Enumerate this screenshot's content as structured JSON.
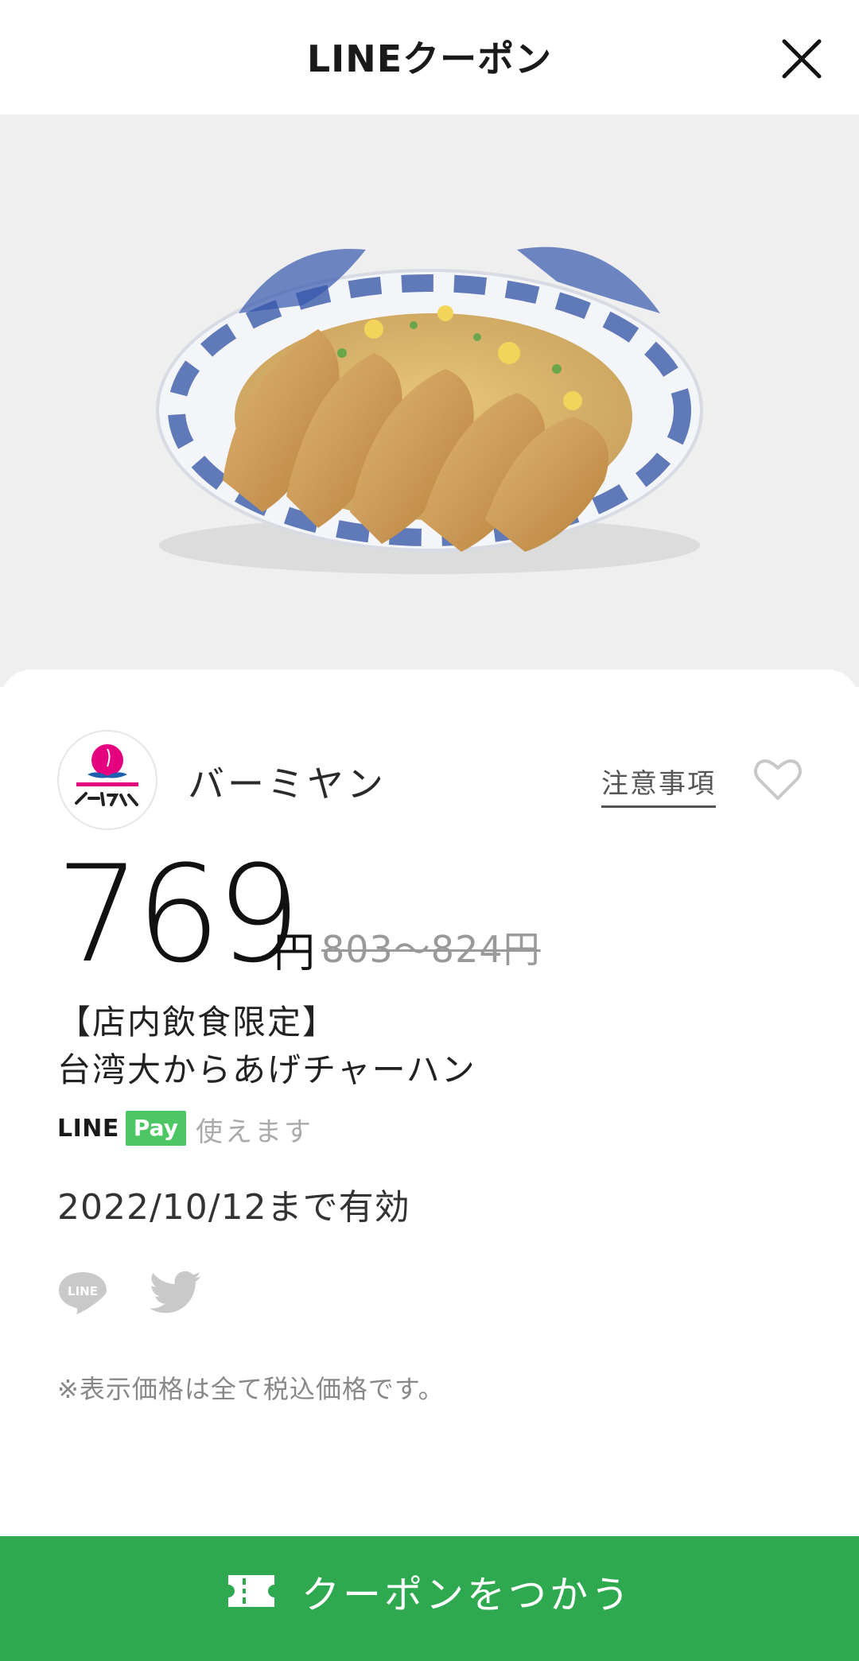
{
  "header": {
    "title": "LINEクーポン",
    "close_icon": "close-icon"
  },
  "hero": {
    "image": "food-photo",
    "alt_icon": "fried-chicken-fried-rice-plate"
  },
  "store": {
    "name": "バーミヤン",
    "logo_icon": "bamiyan-peach-logo",
    "notes_link": "注意事項",
    "favorite_icon": "heart-outline-icon"
  },
  "price": {
    "value": "769",
    "unit": "円",
    "original": "803〜824円"
  },
  "product": {
    "line1": "【店内飲食限定】",
    "line2": "台湾大からあげチャーハン"
  },
  "payment": {
    "brand_line": "LINE",
    "brand_pay": "Pay",
    "status": "使えます"
  },
  "validity": "2022/10/12まで有効",
  "share": {
    "line_icon": "line-share-icon",
    "twitter_icon": "twitter-share-icon"
  },
  "tax_note": "※表示価格は全て税込価格です。",
  "cta": {
    "label": "クーポンをつかう",
    "icon": "ticket-icon"
  },
  "colors": {
    "cta_green": "#2ea950",
    "linepay_green": "#4cc764",
    "logo_pink": "#e4007f"
  }
}
